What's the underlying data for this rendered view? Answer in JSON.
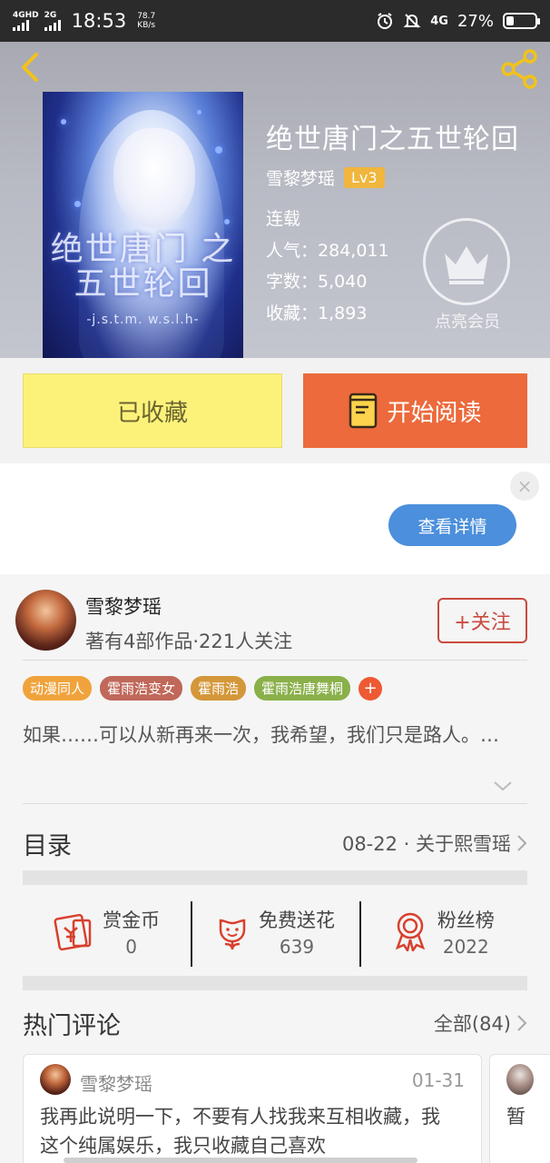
{
  "status_bar": {
    "signal_1": "4GHD",
    "signal_2": "2G",
    "time": "18:53",
    "speed_value": "78.7",
    "speed_unit": "KB/s",
    "network": "4G",
    "battery": "27%",
    "battery_level": 0.27
  },
  "book": {
    "title": "绝世唐门之五世轮回",
    "author": "雪黎梦瑶",
    "level": "Lv3",
    "status": "连载",
    "popularity_label": "人气：",
    "popularity": "284,011",
    "words_label": "字数：",
    "words": "5,040",
    "favorites_label": "收藏：",
    "favorites": "1,893",
    "cover_title": "绝世唐门 之五世轮回",
    "cover_subtitle": "-j.s.t.m. w.s.l.h-",
    "vip_label": "点亮会员"
  },
  "actions": {
    "collected_label": "已收藏",
    "read_label": "开始阅读"
  },
  "ad": {
    "details_label": "查看详情",
    "close_symbol": "×"
  },
  "author_card": {
    "name": "雪黎梦瑶",
    "info": "著有4部作品·221人关注",
    "follow_label": "+关注"
  },
  "tags": [
    {
      "label": "动漫同人",
      "color": "#f0a33c"
    },
    {
      "label": "霍雨浩变女",
      "color": "#c0685a"
    },
    {
      "label": "霍雨浩",
      "color": "#d4973a"
    },
    {
      "label": "霍雨浩唐舞桐",
      "color": "#8ab04a"
    }
  ],
  "tag_more": "+",
  "description": "如果……可以从新再来一次，我希望，我们只是路人。…",
  "toc": {
    "title": "目录",
    "latest": "08-22 · 关于熙雪瑶"
  },
  "stats": [
    {
      "label": "赏金币",
      "value": "0",
      "icon": "red-envelope-icon"
    },
    {
      "label": "免费送花",
      "value": "639",
      "icon": "flower-icon"
    },
    {
      "label": "粉丝榜",
      "value": "2022",
      "icon": "medal-icon"
    }
  ],
  "comments_section": {
    "title": "热门评论",
    "all_label": "全部(84)"
  },
  "comments": [
    {
      "user": "雪黎梦瑶",
      "date": "01-31",
      "text": "我再此说明一下，不要有人找我来互相收藏，我这个纯属娱乐，我只收藏自己喜欢"
    },
    {
      "text": "暂"
    }
  ],
  "colors": {
    "accent_orange": "#ec6a3c",
    "collected_yellow": "#fcf27a",
    "follow_red": "#c94a40",
    "ad_blue": "#4c8fdc",
    "level_badge": "#f0b63d"
  }
}
